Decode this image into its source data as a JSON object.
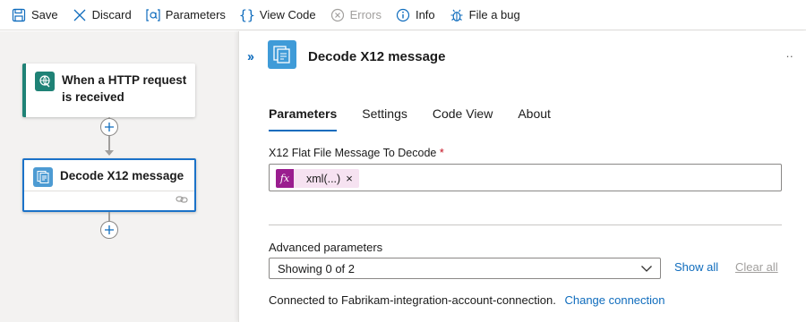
{
  "toolbar": {
    "save": "Save",
    "discard": "Discard",
    "parameters": "Parameters",
    "view_code": "View Code",
    "errors": "Errors",
    "info": "Info",
    "file_bug": "File a bug"
  },
  "designer": {
    "trigger_title": "When a HTTP request is received",
    "action_title": "Decode X12 message"
  },
  "panel": {
    "title": "Decode X12 message",
    "more": "··",
    "tabs": [
      "Parameters",
      "Settings",
      "Code View",
      "About"
    ],
    "active_tab": "Parameters",
    "field_label": "X12 Flat File Message To Decode",
    "required_mark": "*",
    "token_fx": "fx",
    "token_text": "xml(...)",
    "token_remove": "×",
    "advanced_label": "Advanced parameters",
    "advanced_select": "Showing 0 of 2",
    "show_all": "Show all",
    "clear_all": "Clear all",
    "connected_text": "Connected to Fabrikam-integration-account-connection.",
    "change_connection": "Change connection"
  },
  "colors": {
    "accent": "#0f6cbd",
    "trigger": "#1f8276",
    "expression_token": "#9a1d8f"
  }
}
